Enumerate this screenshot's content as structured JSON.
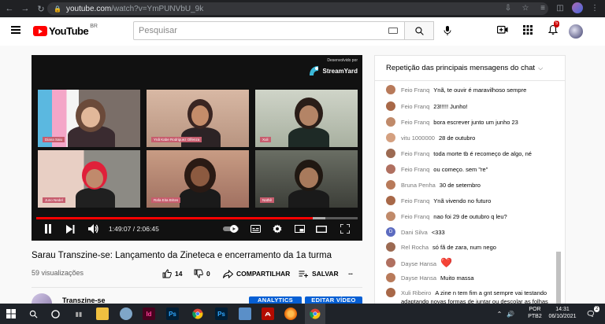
{
  "browser": {
    "url_host": "youtube.com",
    "url_path": "/watch?v=YmPUNVbU_9k"
  },
  "header": {
    "logo_text": "YouTube",
    "region": "BR",
    "search_placeholder": "Pesquisar",
    "notification_count": "5"
  },
  "video": {
    "current_time": "1:49:07",
    "duration": "2:06:45",
    "time_display": "1:49:07 / 2:06:45",
    "played_fraction": 0.86,
    "loaded_fraction": 0.9,
    "watermark_caption": "Desenvolvido por",
    "watermark_name": "StreamYard",
    "participants": [
      "Diana Saiu",
      "Ynã Kabe Rodriguez Olfenza",
      "Xuli",
      "Juno Nedel",
      "Rafa Eita Brites",
      "Nathê"
    ],
    "title": "Sarau Transzine-se: Lançamento da Zineteca e encerramento da 1a turma",
    "views": "59 visualizações",
    "likes": "14",
    "dislikes": "0",
    "share_label": "COMPARTILHAR",
    "save_label": "SALVAR",
    "more_label": "···",
    "channel_name": "Transzine-se",
    "analytics_label": "ANALYTICS",
    "edit_label": "EDITAR VÍDEO"
  },
  "chat": {
    "header": "Repetição das principais mensagens do chat",
    "messages": [
      {
        "author": "Feio Franq",
        "text": "Ynã, te ouvir é maravilhoso sempre",
        "avatar": "photo"
      },
      {
        "author": "Feio Franq",
        "text": "23!!!!! Junho!",
        "avatar": "photo"
      },
      {
        "author": "Feio Franq",
        "text": "bora escrever junto um junho 23",
        "avatar": "photo"
      },
      {
        "author": "vitu 1000000",
        "text": "28 de outubro",
        "avatar": "photo"
      },
      {
        "author": "Feio Franq",
        "text": "toda morte tb é recomeço de algo, né",
        "avatar": "photo"
      },
      {
        "author": "Feio Franq",
        "text": "ou começo. sem \"re\"",
        "avatar": "photo"
      },
      {
        "author": "Bruna Penha",
        "text": "30 de setembro",
        "avatar": "photo"
      },
      {
        "author": "Feio Franq",
        "text": "Ynã vivendo no futuro",
        "avatar": "photo"
      },
      {
        "author": "Feio Franq",
        "text": "nao foi 29 de outubro q leu?",
        "avatar": "photo"
      },
      {
        "author": "Dani Silva",
        "text": "<333",
        "avatar": "D"
      },
      {
        "author": "Rel Rocha",
        "text": "só fã de zara, num nego",
        "avatar": "photo"
      },
      {
        "author": "Dayse Hansa",
        "text": "❤️",
        "avatar": "photo"
      },
      {
        "author": "Dayse Hansa",
        "text": "Muito massa",
        "avatar": "photo"
      },
      {
        "author": "Xuli Ribeiro",
        "text": "A zine n tem fim a gnt sempre vai testando adaptando novas formas de juntar ou descolar as folhas",
        "avatar": "photo"
      }
    ]
  },
  "taskbar": {
    "language": "POR",
    "layout": "PTB2",
    "time": "14:31",
    "date": "06/10/2021",
    "notification_count": "2",
    "apps": [
      "Id",
      "Ps",
      "Ps"
    ]
  },
  "colors": {
    "youtube_red": "#ff0000",
    "action_blue": "#065fd4",
    "streamyard_label": "#c75d6e"
  }
}
